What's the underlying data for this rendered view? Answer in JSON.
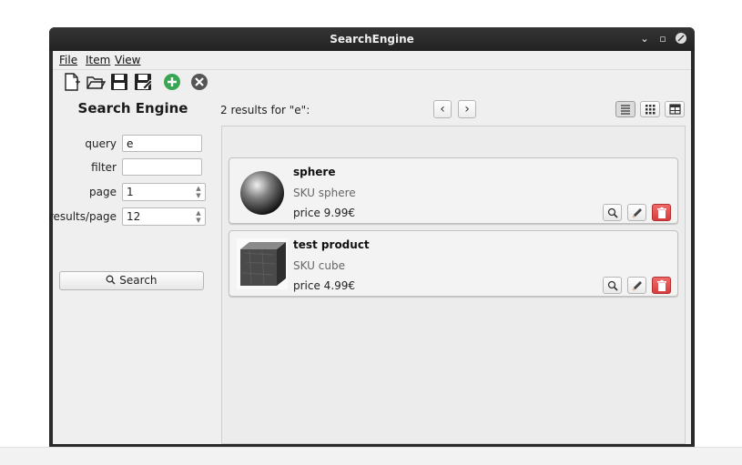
{
  "window": {
    "title": "SearchEngine"
  },
  "menu": {
    "file": "File",
    "item": "Item",
    "view": "View"
  },
  "toolbar": {
    "icons": [
      "new-document-icon",
      "open-folder-icon",
      "save-icon",
      "save-as-icon",
      "add-icon",
      "close-icon"
    ]
  },
  "sidebar": {
    "title": "Search Engine",
    "query_label": "query",
    "query_value": "e",
    "filter_label": "filter",
    "filter_value": "",
    "page_label": "page",
    "page_value": "1",
    "results_label": "results/page",
    "results_value": "12",
    "search_button": "Search"
  },
  "results": {
    "summary": "2 results for \"e\":",
    "items": [
      {
        "name": "sphere",
        "sku": "SKU sphere",
        "price": "price 9.99€",
        "thumb": "sphere-thumbnail"
      },
      {
        "name": "test product",
        "sku": "SKU cube",
        "price": "price 4.99€",
        "thumb": "cube-thumbnail"
      }
    ]
  },
  "colors": {
    "delete": "#d83c3c",
    "add": "#3aa655",
    "titlebar": "#2a2a2a"
  }
}
